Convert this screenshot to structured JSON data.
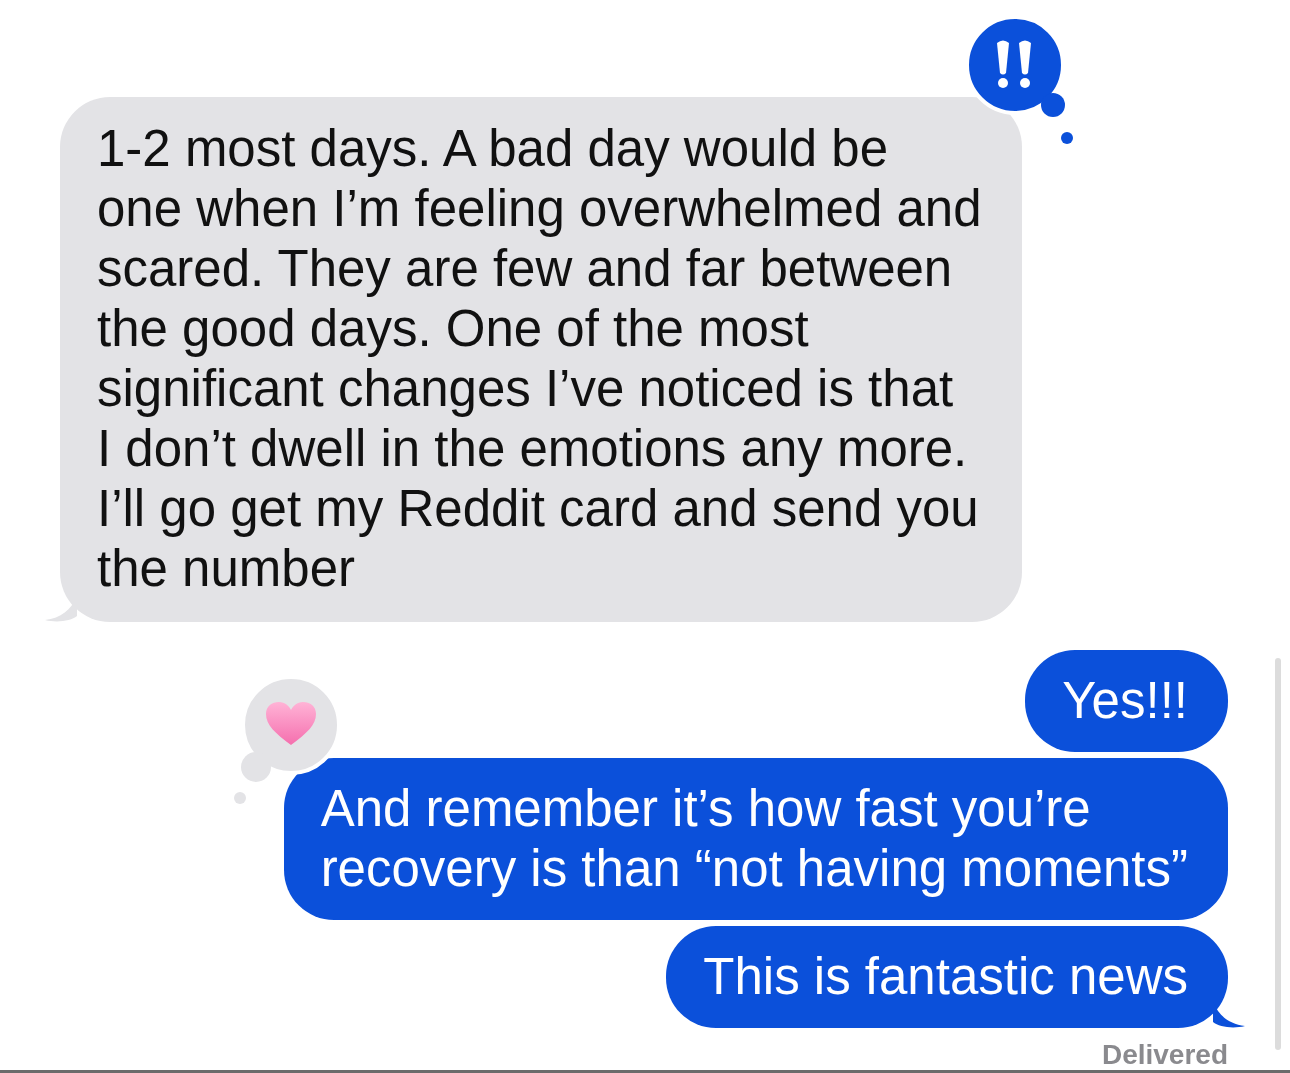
{
  "messages": [
    {
      "kind": "incoming",
      "lines": [
        "1-2 most days. A bad day would be",
        "one when I’m feeling overwhelmed and",
        "scared. They are few and far between",
        "the good days. One of the most",
        "significant changes I’ve noticed is that",
        "I don’t dwell in the emotions any more.",
        "I’ll go get my Reddit card and send you",
        "the number"
      ],
      "tail": true,
      "reaction": {
        "kind": "emphasis"
      }
    },
    {
      "kind": "outgoing",
      "lines": [
        "Yes!!!"
      ],
      "tail": false
    },
    {
      "kind": "outgoing",
      "lines": [
        "And remember it’s how fast you’re",
        "recovery is than “not having moments”"
      ],
      "tail": false,
      "reaction": {
        "kind": "heart"
      }
    },
    {
      "kind": "outgoing",
      "lines": [
        "This is fantastic news"
      ],
      "tail": true
    }
  ],
  "status": "Delivered"
}
